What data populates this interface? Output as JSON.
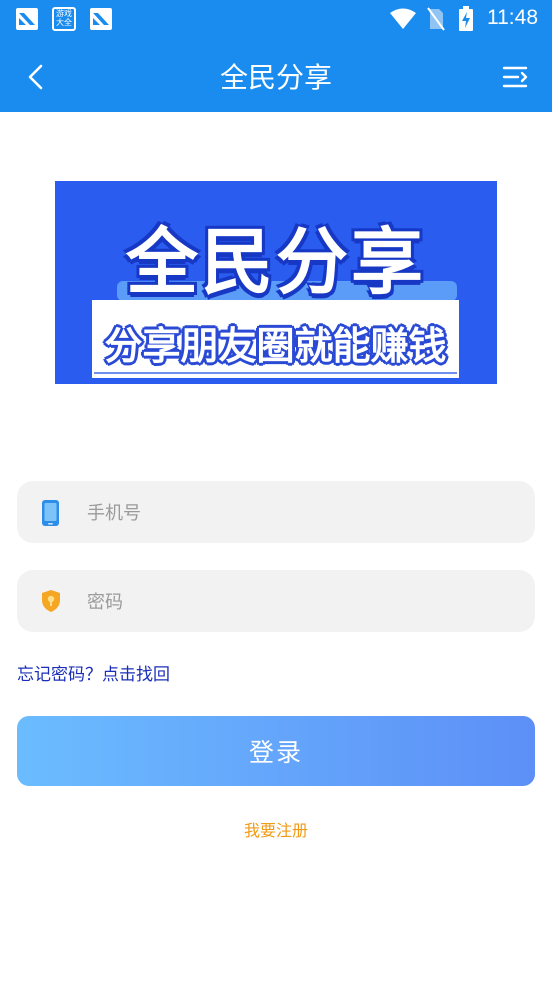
{
  "status_bar": {
    "time": "11:48",
    "game_icon_text": "游戏大全"
  },
  "titlebar": {
    "title": "全民分享",
    "back_icon": "chevron-left-icon",
    "menu_icon": "menu-icon"
  },
  "banner": {
    "headline": "全民分享",
    "subline": "分享朋友圈就能赚钱"
  },
  "form": {
    "phone_placeholder": "手机号",
    "password_placeholder": "密码",
    "forgot_text": "忘记密码？点击找回",
    "login_label": "登录",
    "register_label": "我要注册"
  },
  "colors": {
    "header_blue": "#1a8cf0",
    "banner_blue": "#2a5cef",
    "forgot_link": "#1a2fb8",
    "register_link": "#f19a15",
    "button_gradient_start": "#6bbcff",
    "button_gradient_end": "#5d8ff7"
  }
}
